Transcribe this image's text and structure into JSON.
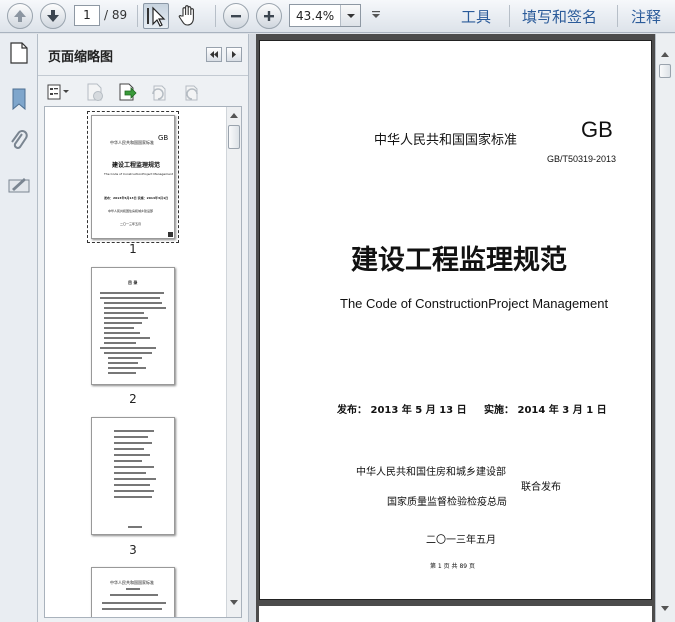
{
  "toolbar": {
    "page_current": "1",
    "page_total": "/ 89",
    "zoom": "43.4%",
    "links": [
      "工具",
      "填写和签名",
      "注释"
    ]
  },
  "panel": {
    "title": "页面缩略图",
    "thumbnails": [
      {
        "num": "1"
      },
      {
        "num": "2"
      },
      {
        "num": "3"
      }
    ]
  },
  "document": {
    "std_title": "中华人民共和国国家标准",
    "gb": "GB",
    "std_code": "GB/T50319-2013",
    "main_title": "建设工程监理规范",
    "en_title": "The Code of ConstructionProject Management",
    "issue": "发布： 2013 年 5 月 13 日",
    "effective": "实施： 2014 年 3 月 1 日",
    "publisher1": "中华人民共和国住房和城乡建设部",
    "publisher2": "国家质量监督检验检疫总局",
    "joint": "联合发布",
    "date": "二〇一三年五月",
    "page_footer": "第 1 页 共 89 页"
  },
  "thumb1": {
    "std_title": "中华人民共和国国家标准",
    "gb": "GB",
    "main_title": "建设工程监理规范",
    "en_title": "The Code of ConstructionProject Management",
    "issue_line": "发布：2013年5月13日   实施：2014年3月1日",
    "pub": "中华人民共和国住房和城乡建设部",
    "date": "二〇一三年五月"
  },
  "thumb2": {
    "heading": "目  录"
  },
  "thumb4": {
    "heading": "中华人民共和国国家标准"
  },
  "colors": {
    "link": "#2b5b9a",
    "viewer_bg": "#4c4c4c"
  }
}
